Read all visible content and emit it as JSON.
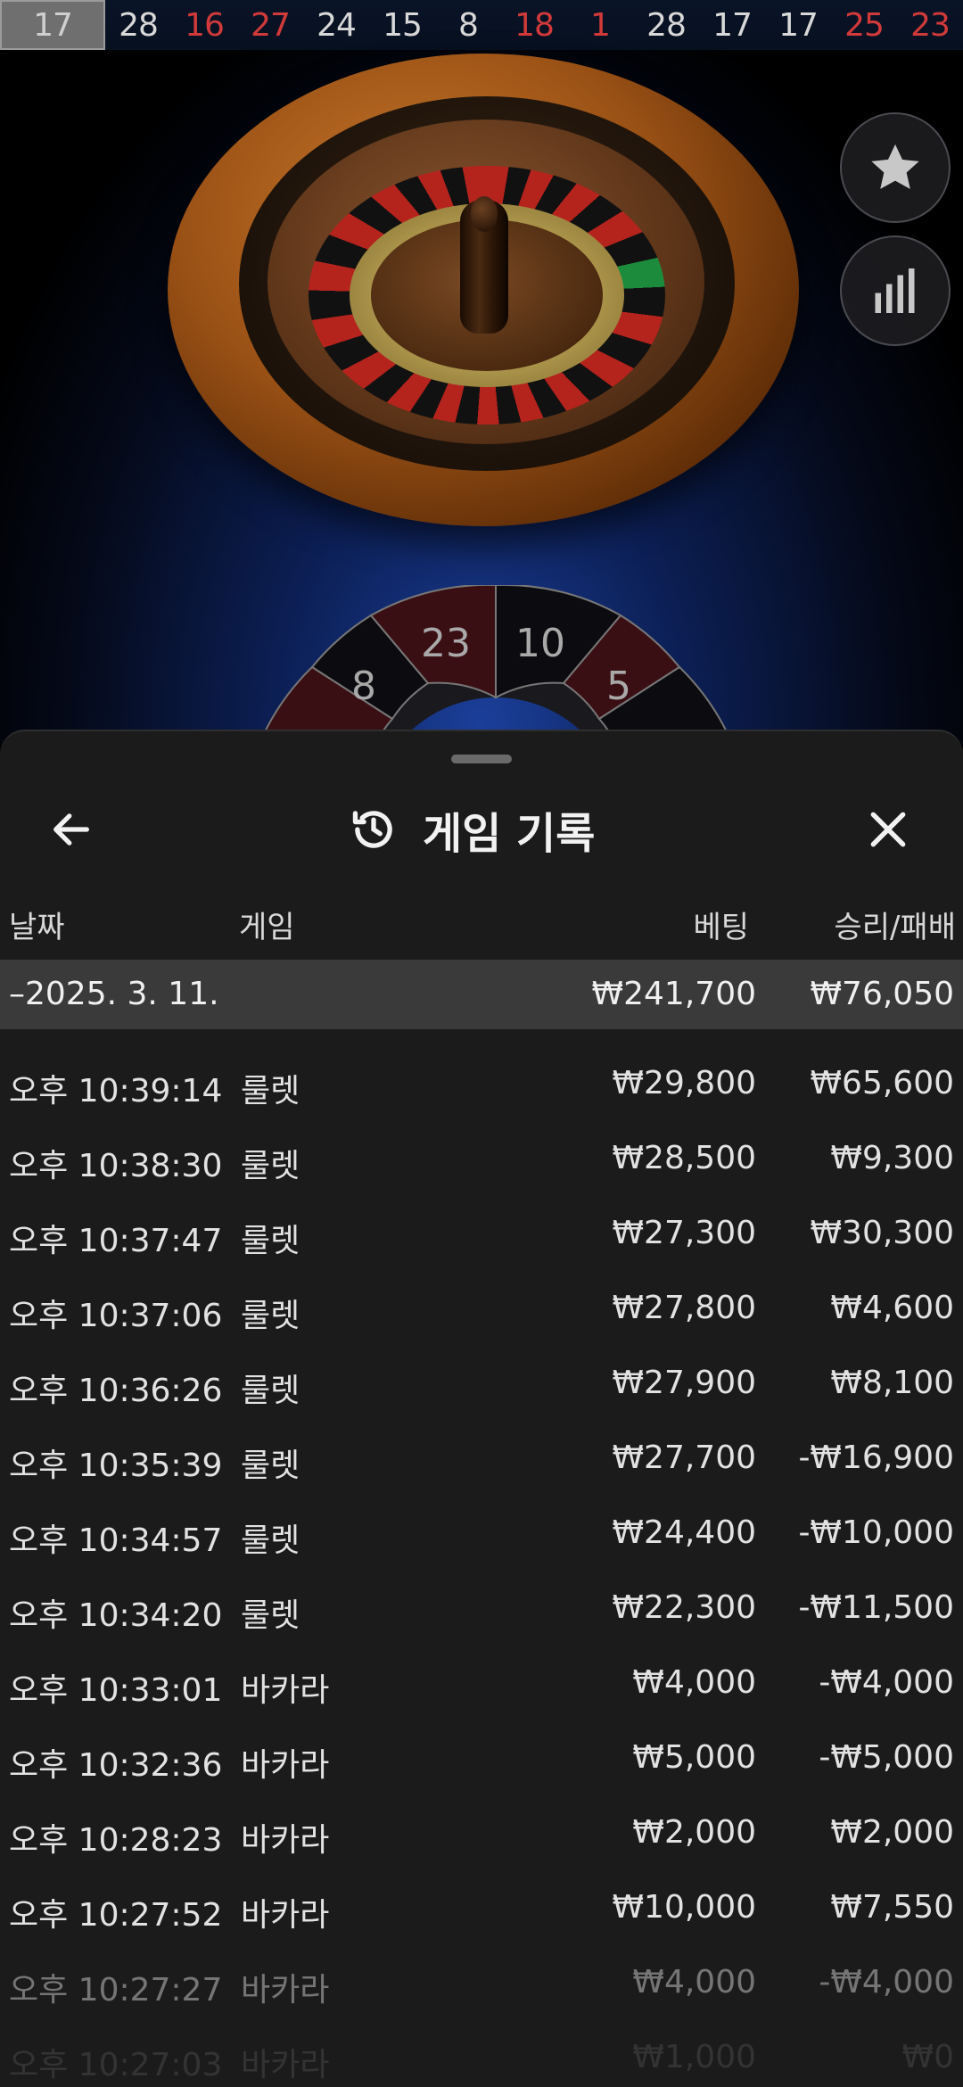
{
  "results": [
    {
      "value": "17",
      "color": "gray"
    },
    {
      "value": "28",
      "color": "black"
    },
    {
      "value": "16",
      "color": "red"
    },
    {
      "value": "27",
      "color": "red"
    },
    {
      "value": "24",
      "color": "black"
    },
    {
      "value": "15",
      "color": "black"
    },
    {
      "value": "8",
      "color": "black"
    },
    {
      "value": "18",
      "color": "red"
    },
    {
      "value": "1",
      "color": "red"
    },
    {
      "value": "28",
      "color": "black"
    },
    {
      "value": "17",
      "color": "black"
    },
    {
      "value": "17",
      "color": "black"
    },
    {
      "value": "25",
      "color": "red"
    },
    {
      "value": "23",
      "color": "red"
    }
  ],
  "track": {
    "seg_8": "8",
    "seg_23": "23",
    "seg_10": "10",
    "seg_5": "5"
  },
  "sheet": {
    "title": "게임 기록",
    "columns": {
      "date": "날짜",
      "game": "게임",
      "bet": "베팅",
      "result": "승리/패배"
    },
    "date_group": {
      "label": "–2025. 3. 11.",
      "bet_total": "₩241,700",
      "result_total": "₩76,050"
    },
    "rows": [
      {
        "time": "오후 10:39:14",
        "game": "룰렛",
        "bet": "₩29,800",
        "result": "₩65,600"
      },
      {
        "time": "오후 10:38:30",
        "game": "룰렛",
        "bet": "₩28,500",
        "result": "₩9,300"
      },
      {
        "time": "오후 10:37:47",
        "game": "룰렛",
        "bet": "₩27,300",
        "result": "₩30,300"
      },
      {
        "time": "오후 10:37:06",
        "game": "룰렛",
        "bet": "₩27,800",
        "result": "₩4,600"
      },
      {
        "time": "오후 10:36:26",
        "game": "룰렛",
        "bet": "₩27,900",
        "result": "₩8,100"
      },
      {
        "time": "오후 10:35:39",
        "game": "룰렛",
        "bet": "₩27,700",
        "result": "-₩16,900"
      },
      {
        "time": "오후 10:34:57",
        "game": "룰렛",
        "bet": "₩24,400",
        "result": "-₩10,000"
      },
      {
        "time": "오후 10:34:20",
        "game": "룰렛",
        "bet": "₩22,300",
        "result": "-₩11,500"
      },
      {
        "time": "오후 10:33:01",
        "game": "바카라",
        "bet": "₩4,000",
        "result": "-₩4,000"
      },
      {
        "time": "오후 10:32:36",
        "game": "바카라",
        "bet": "₩5,000",
        "result": "-₩5,000"
      },
      {
        "time": "오후 10:28:23",
        "game": "바카라",
        "bet": "₩2,000",
        "result": "₩2,000"
      },
      {
        "time": "오후 10:27:52",
        "game": "바카라",
        "bet": "₩10,000",
        "result": "₩7,550"
      },
      {
        "time": "오후 10:27:27",
        "game": "바카라",
        "bet": "₩4,000",
        "result": "-₩4,000"
      },
      {
        "time": "오후 10:27:03",
        "game": "바카라",
        "bet": "₩1,000",
        "result": "₩0"
      }
    ]
  },
  "icons": {
    "back": "arrow-left-icon",
    "history": "history-icon",
    "close": "close-icon",
    "favorite": "star-icon",
    "statistics": "bar-chart-icon"
  },
  "colors": {
    "red_number": "#d23a3a",
    "sheet_bg": "#1b1b1b",
    "date_row_bg": "#3a3a3a"
  }
}
